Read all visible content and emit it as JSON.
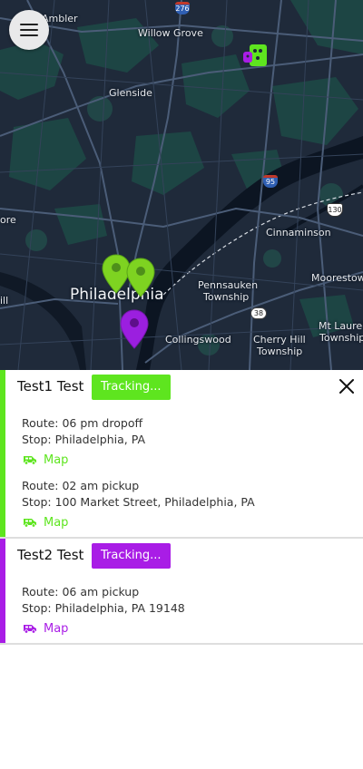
{
  "colors": {
    "green": "#5ee51f",
    "purple": "#a91de6",
    "pin_green": "#7ed321",
    "pin_purple": "#9b1fdf"
  },
  "map": {
    "labels": {
      "ambler": "Ambler",
      "willow_grove": "Willow Grove",
      "glenside": "Glenside",
      "ore": "ore",
      "cinnaminson": "Cinnaminson",
      "moorestown": "Moorestown",
      "philadelphia": "Philadelphia",
      "pennsauken": "Pennsauken",
      "township1": "Township",
      "ill": "ill",
      "collingswood": "Collingswood",
      "cherry_hill": "Cherry Hill",
      "township2": "Township",
      "mt_laurel": "Mt Laurel",
      "township3": "Township"
    },
    "shields": {
      "i276": "276",
      "i95": "95",
      "us130": "130",
      "r38": "38"
    },
    "icons": {
      "menu": "hamburger-menu-icon",
      "pin": "map-pin-icon",
      "cluster": "marker-cluster-icon"
    }
  },
  "people": [
    {
      "name": "Test1 Test",
      "status": "Tracking...",
      "routes": [
        {
          "route": "Route: 06 pm dropoff",
          "stop": "Stop: Philadelphia, PA",
          "map": "Map"
        },
        {
          "route": "Route: 02 am pickup",
          "stop": "Stop: 100 Market Street, Philadelphia, PA",
          "map": "Map"
        }
      ]
    },
    {
      "name": "Test2 Test",
      "status": "Tracking...",
      "routes": [
        {
          "route": "Route: 06 am pickup",
          "stop": "Stop: Philadelphia, PA 19148",
          "map": "Map"
        }
      ]
    }
  ]
}
